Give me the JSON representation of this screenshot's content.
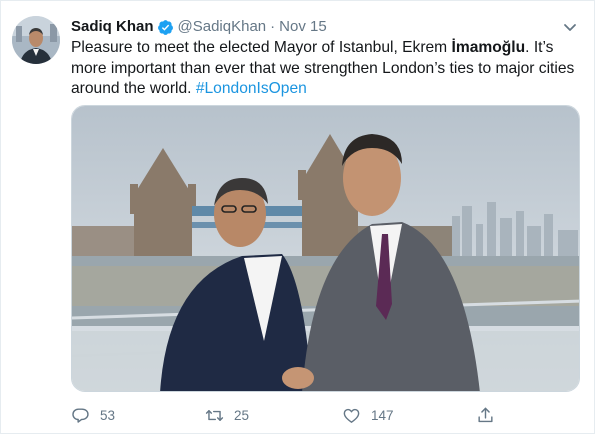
{
  "author": {
    "display_name": "Sadiq Khan",
    "handle": "@SadiqKhan",
    "separator": "·",
    "date": "Nov 15"
  },
  "text": {
    "part1": "Pleasure to meet the elected Mayor of Istanbul, Ekrem ",
    "bold": "İmamoğlu",
    "part2": ". It’s more important than ever that we strengthen London’s ties to major cities around the world. ",
    "hashtag": "#LondonIsOpen"
  },
  "icons": {
    "verified": "verified-badge-icon",
    "caret": "chevron-down-icon",
    "reply": "reply-icon",
    "retweet": "retweet-icon",
    "like": "heart-icon",
    "share": "share-icon"
  },
  "actions": {
    "replies": "53",
    "retweets": "25",
    "likes": "147"
  },
  "colors": {
    "link": "#1b95e0",
    "verified": "#1da1f2",
    "muted": "#657786"
  }
}
